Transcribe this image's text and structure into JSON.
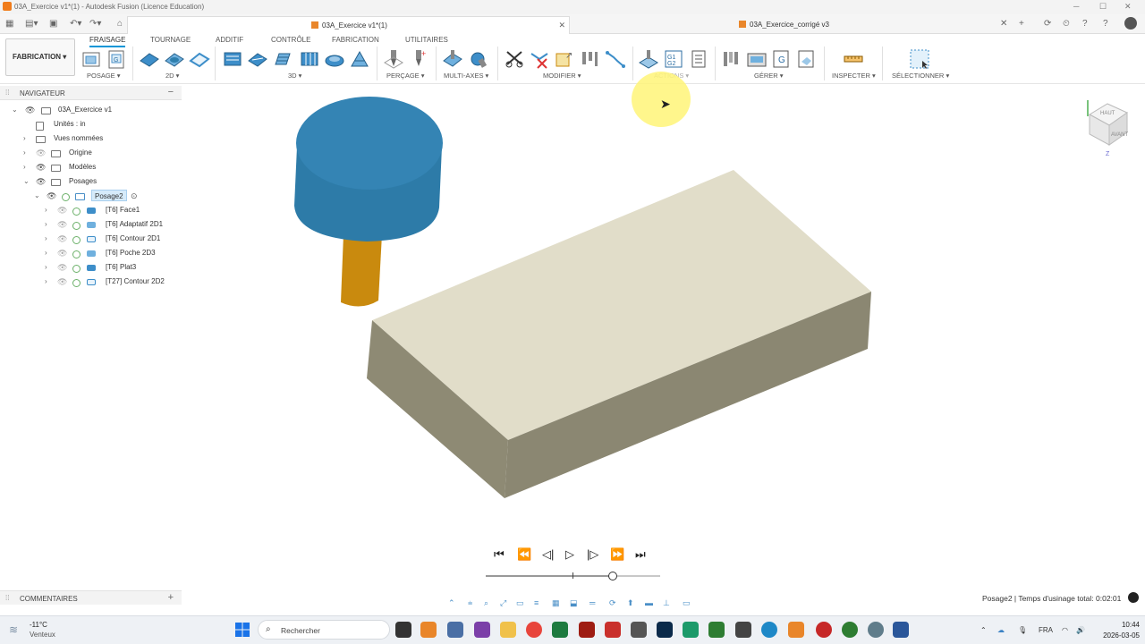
{
  "window": {
    "title": "03A_Exercice v1*(1) - Autodesk Fusion (Licence Education)"
  },
  "tabs": {
    "active": "03A_Exercice v1*(1)",
    "inactive": "03A_Exercice_corrigé v3"
  },
  "ribbon": {
    "workspace": "FABRICATION",
    "tabs": [
      "FRAISAGE",
      "TOURNAGE",
      "ADDITIF",
      "CONTRÔLE",
      "FABRICATION",
      "UTILITAIRES"
    ],
    "active_tab": "FRAISAGE",
    "groups": {
      "posage": "POSAGE",
      "two_d": "2D",
      "three_d": "3D",
      "percage": "PERÇAGE",
      "multi_axes": "MULTI-AXES",
      "modifier": "MODIFIER",
      "actions": "ACTIONS",
      "gerer": "GÉRER",
      "inspecter": "INSPECTER",
      "selectionner": "SÉLECTIONNER"
    }
  },
  "navigator": {
    "header": "NAVIGATEUR",
    "root": "03A_Exercice v1",
    "units": "Unités : in",
    "named_views": "Vues nommées",
    "origin": "Origine",
    "models": "Modèles",
    "setups": "Posages",
    "setup": "Posage2",
    "operations": [
      "[T6] Face1",
      "[T6] Adaptatif 2D1",
      "[T6] Contour 2D1",
      "[T6] Poche 2D3",
      "[T6] Plat3",
      "[T27] Contour 2D2"
    ]
  },
  "comments": {
    "label": "COMMENTAIRES"
  },
  "viewcube": {
    "top": "HAUT",
    "front": "AVANT",
    "axis": "Z"
  },
  "simulation": {
    "progress": 0.73
  },
  "status": {
    "text": "Posage2 | Temps d'usinage total: 0:02:01"
  },
  "taskbar": {
    "temperature": "-11°C",
    "weather": "Venteux",
    "search": "Rechercher",
    "language": "FRA",
    "time": "10:44",
    "date": "2026-03-05"
  },
  "colors": {
    "accent": "#0696d7",
    "stock_top": "#e0dcc8",
    "stock_side": "#8f8b76",
    "tool_holder": "#2e7fad",
    "tool_shank": "#c98a0e"
  }
}
